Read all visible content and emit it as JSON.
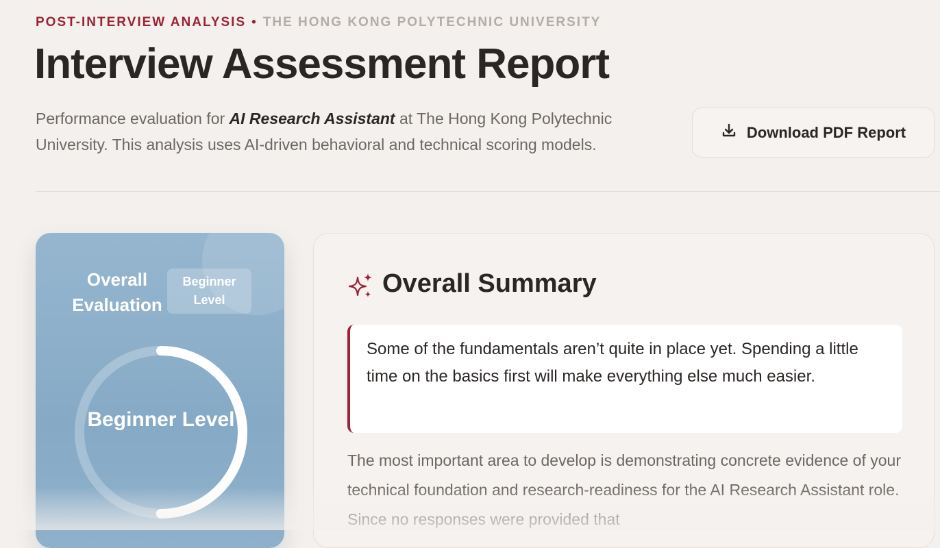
{
  "header": {
    "eyebrow_primary": "POST-INTERVIEW ANALYSIS",
    "eyebrow_separator": "•",
    "eyebrow_secondary": "THE HONG KONG POLYTECHNIC UNIVERSITY",
    "title": "Interview Assessment Report",
    "description_prefix": "Performance evaluation for ",
    "description_role": "AI Research Assistant",
    "description_suffix": " at The Hong Kong Polytechnic University. This analysis uses AI-driven behavioral and technical scoring models."
  },
  "download_button": {
    "label": "Download PDF Report",
    "icon": "download-icon"
  },
  "evaluation_card": {
    "title": "Overall Evaluation",
    "badge": "Beginner Level",
    "ring_label": "Beginner Level",
    "ring_progress": 0.5
  },
  "summary": {
    "icon": "sparkles-icon",
    "heading": "Overall Summary",
    "quote": "Some of the fundamentals aren’t quite in place yet. Spending a little time on the basics first will make everything else much easier.",
    "body": "The most important area to develop is demonstrating concrete evidence of your technical foundation and research-readiness for the AI Research Assistant role. Since no responses were provided that"
  },
  "colors": {
    "accent": "#9b2335",
    "background": "#f3f0ed",
    "card_blue": "#8eb0cb"
  }
}
